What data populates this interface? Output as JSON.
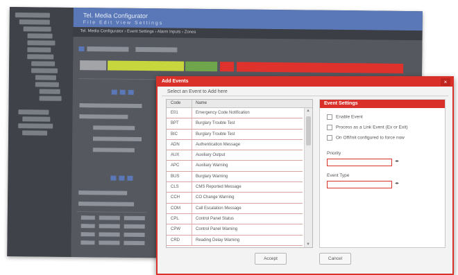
{
  "background_app": {
    "title": "Tel. Media Configurator",
    "menu": "File  Edit  View  Settings",
    "breadcrumb": "Tel. Media Configurator › Event Settings › Alarm Inputs › Zones"
  },
  "dialog": {
    "title": "Add Events",
    "close_glyph": "×",
    "subtitle": "Select an Event to Add here",
    "list": {
      "headers": {
        "code": "Code",
        "name": "Name"
      },
      "rows": [
        {
          "code": "E01",
          "name": "Emergency Code Notification"
        },
        {
          "code": "BPT",
          "name": "Burglary Trouble Test"
        },
        {
          "code": "BIC",
          "name": "Burglary Trouble Test"
        },
        {
          "code": "ADN",
          "name": "Authentication Message"
        },
        {
          "code": "AUX",
          "name": "Auxiliary Output"
        },
        {
          "code": "APC",
          "name": "Auxiliary Warning"
        },
        {
          "code": "BUS",
          "name": "Burglary Warning"
        },
        {
          "code": "CLS",
          "name": "CMS Reported Message"
        },
        {
          "code": "CCH",
          "name": "CO Change Warning"
        },
        {
          "code": "COM",
          "name": "Call Escalation Message"
        },
        {
          "code": "CPL",
          "name": "Control Panel Status"
        },
        {
          "code": "CPW",
          "name": "Control Panel Warning"
        },
        {
          "code": "CRD",
          "name": "Reading Delay Warning"
        }
      ]
    },
    "settings": {
      "title": "Event Settings",
      "options": [
        "Enable Event",
        "Process as a Link Event (Ex or Exit)",
        "On Off/Init configured to force now"
      ],
      "fields": [
        {
          "label": "Priority",
          "value": ""
        },
        {
          "label": "Event Type",
          "value": ""
        }
      ],
      "spinner_glyph": "◂▸"
    },
    "buttons": {
      "ok": "Accept",
      "cancel": "Cancel"
    }
  },
  "colors": {
    "dialog_accent": "#d9312a",
    "app_header": "#5a78b8",
    "status_yellow": "#c7d63c",
    "status_red": "#e0322c"
  }
}
